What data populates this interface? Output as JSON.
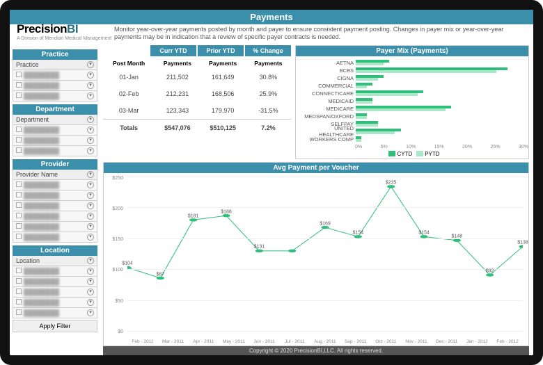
{
  "header": {
    "title": "Payments"
  },
  "logo": {
    "main_a": "Precision",
    "main_b": "BI",
    "tag": "A Division of Meridian Medical Management"
  },
  "description": "Monitor year-over-year payments posted by month and payer to ensure consistent payment posting.  Changes in payer mix or year-over-year payments may be in indication that a review of specific payer contracts is needed.",
  "sidebar": {
    "sections": [
      {
        "title": "Practice",
        "header_label": "Practice",
        "items": [
          "",
          "",
          ""
        ]
      },
      {
        "title": "Department",
        "header_label": "Department",
        "items": [
          "",
          "",
          ""
        ]
      },
      {
        "title": "Provider",
        "header_label": "Provider Name",
        "items": [
          "",
          "",
          "",
          "",
          "",
          ""
        ]
      },
      {
        "title": "Location",
        "header_label": "Location",
        "items": [
          "",
          "",
          "",
          "",
          ""
        ]
      }
    ],
    "apply_label": "Apply Filter"
  },
  "table": {
    "col_groups": [
      "",
      "Curr YTD",
      "Prior YTD",
      "% Change"
    ],
    "columns": [
      "Post Month",
      "Payments",
      "Payments",
      "Payments"
    ],
    "rows": [
      {
        "month": "01-Jan",
        "curr": "211,502",
        "prior": "161,649",
        "chg": "30.8%"
      },
      {
        "month": "02-Feb",
        "curr": "212,231",
        "prior": "168,506",
        "chg": "25.9%"
      },
      {
        "month": "03-Mar",
        "curr": "123,343",
        "prior": "179,970",
        "chg": "-31.5%"
      }
    ],
    "totals": {
      "label": "Totals",
      "curr": "$547,076",
      "prior": "$510,125",
      "chg": "7.2%"
    }
  },
  "chart_data": [
    {
      "type": "bar",
      "title": "Payer Mix (Payments)",
      "orientation": "horizontal",
      "xlabel": "",
      "ylabel": "",
      "xlim": [
        0,
        30
      ],
      "xticks": [
        0,
        5,
        10,
        15,
        20,
        25,
        30
      ],
      "categories": [
        "AETNA",
        "BCBS",
        "CIGNA",
        "COMMERCIAL",
        "CONNECTICARE",
        "MEDICAID",
        "MEDICARE",
        "MEDSPAN/OXFORD",
        "SELFPAY",
        "UNITED HEALTHCARE",
        "WORKERS COMP"
      ],
      "series": [
        {
          "name": "CYTD",
          "color": "#2fbf7a",
          "values": [
            6,
            27,
            5,
            3,
            12,
            3,
            17,
            2,
            4,
            8,
            1
          ]
        },
        {
          "name": "PYTD",
          "color": "#a8e8c8",
          "values": [
            5,
            25,
            4,
            2,
            11,
            3,
            16,
            2,
            4,
            7,
            1
          ]
        }
      ],
      "legend_position": "bottom"
    },
    {
      "type": "line",
      "title": "Avg Payment per Voucher",
      "ylim": [
        0,
        250
      ],
      "yticks": [
        0,
        50,
        100,
        150,
        200,
        250
      ],
      "categories": [
        "Feb - 2011",
        "Mar - 2011",
        "Apr - 2011",
        "May - 2011",
        "Jun - 2011",
        "Jul - 2011",
        "Aug - 2011",
        "Sep - 2011",
        "Oct - 2011",
        "Nov - 2011",
        "Dec - 2011",
        "Jan - 2012",
        "Feb - 2012"
      ],
      "series": [
        {
          "name": "Avg Payment",
          "color": "#2fbf7a",
          "values": [
            104,
            87,
            181,
            188,
            131,
            131,
            169,
            154,
            235,
            154,
            148,
            92,
            138
          ],
          "labels": [
            "$104",
            "$87",
            "$181",
            "$188",
            "$131",
            "",
            "$169",
            "$154",
            "$235",
            "$154",
            "$148",
            "$92",
            "$138"
          ]
        }
      ]
    }
  ],
  "footer": {
    "text": "Copyright © 2020 PrecisionBI,LLC.  All rights reserved."
  }
}
